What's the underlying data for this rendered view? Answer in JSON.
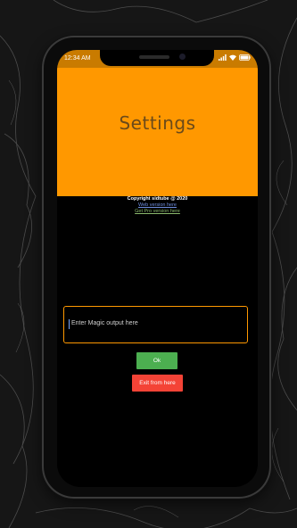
{
  "status_bar": {
    "time": "12:34 AM",
    "battery": "99"
  },
  "header": {
    "title": "Settings"
  },
  "footer_links": {
    "copyright": "Copyright sidtube @ 2020",
    "web_version": "Web version here",
    "pro_version": "Get Pro version here"
  },
  "magic_input": {
    "placeholder": "Enter Magic output here"
  },
  "buttons": {
    "ok_label": "Ok",
    "exit_label": "Exit from here"
  },
  "colors": {
    "header": "#ff9800",
    "status_bar": "#c97b00",
    "ok_button": "#4caf50",
    "exit_button": "#f44336",
    "input_border": "#ff9800"
  }
}
